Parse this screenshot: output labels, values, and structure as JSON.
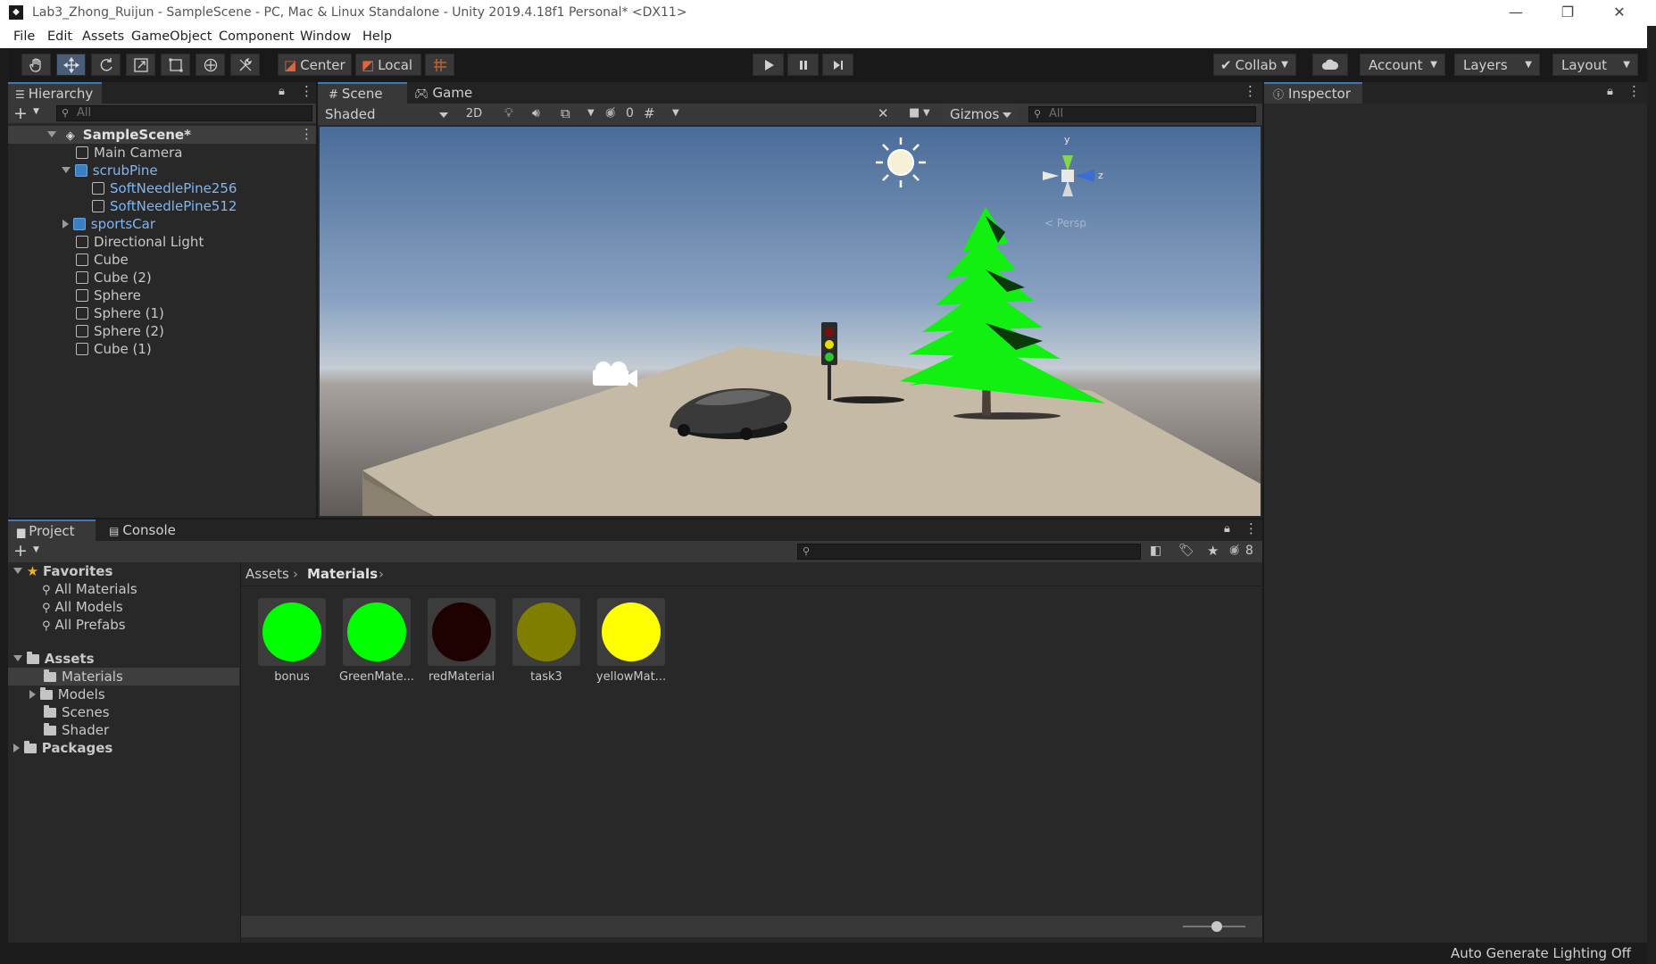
{
  "window": {
    "title": "Lab3_Zhong_Ruijun - SampleScene - PC, Mac & Linux Standalone - Unity 2019.4.18f1 Personal* <DX11>",
    "minimize": "—",
    "restore": "❐",
    "close": "✕"
  },
  "menu": [
    "File",
    "Edit",
    "Assets",
    "GameObject",
    "Component",
    "Window",
    "Help"
  ],
  "toolbar": {
    "pivot_center": "Center",
    "pivot_local": "Local",
    "collab": "Collab",
    "account": "Account",
    "layers": "Layers",
    "layout": "Layout"
  },
  "hierarchy": {
    "tab": "Hierarchy",
    "search_placeholder": "All",
    "scene": "SampleScene*",
    "items": [
      {
        "label": "Main Camera"
      },
      {
        "label": "scrubPine"
      },
      {
        "label": "SoftNeedlePine256"
      },
      {
        "label": "SoftNeedlePine512"
      },
      {
        "label": "sportsCar"
      },
      {
        "label": "Directional Light"
      },
      {
        "label": "Cube"
      },
      {
        "label": "Cube (2)"
      },
      {
        "label": "Sphere"
      },
      {
        "label": "Sphere (1)"
      },
      {
        "label": "Sphere (2)"
      },
      {
        "label": "Cube (1)"
      }
    ]
  },
  "scene_view": {
    "tab_scene": "Scene",
    "tab_game": "Game",
    "draw_mode": "Shaded",
    "mode_2d": "2D",
    "hidden_count": "0",
    "gizmos": "Gizmos",
    "search_placeholder": "All",
    "gizmo_y": "y",
    "gizmo_z": "z",
    "persp": "< Persp"
  },
  "inspector": {
    "tab": "Inspector"
  },
  "project": {
    "tab_project": "Project",
    "tab_console": "Console",
    "hidden_count": "8",
    "favorites": {
      "title": "Favorites",
      "items": [
        "All Materials",
        "All Models",
        "All Prefabs"
      ]
    },
    "assets": {
      "title": "Assets",
      "items": [
        "Materials",
        "Models",
        "Scenes",
        "Shader"
      ]
    },
    "packages": "Packages",
    "breadcrumb": [
      "Assets",
      "Materials"
    ],
    "materials": [
      {
        "name": "bonus",
        "color": "#00ff00"
      },
      {
        "name": "GreenMate...",
        "color": "#00ff00"
      },
      {
        "name": "redMaterial",
        "color": "#1e0202"
      },
      {
        "name": "task3",
        "color": "#807e00"
      },
      {
        "name": "yellowMat...",
        "color": "#ffff00"
      }
    ]
  },
  "status": {
    "lighting": "Auto Generate Lighting Off"
  }
}
